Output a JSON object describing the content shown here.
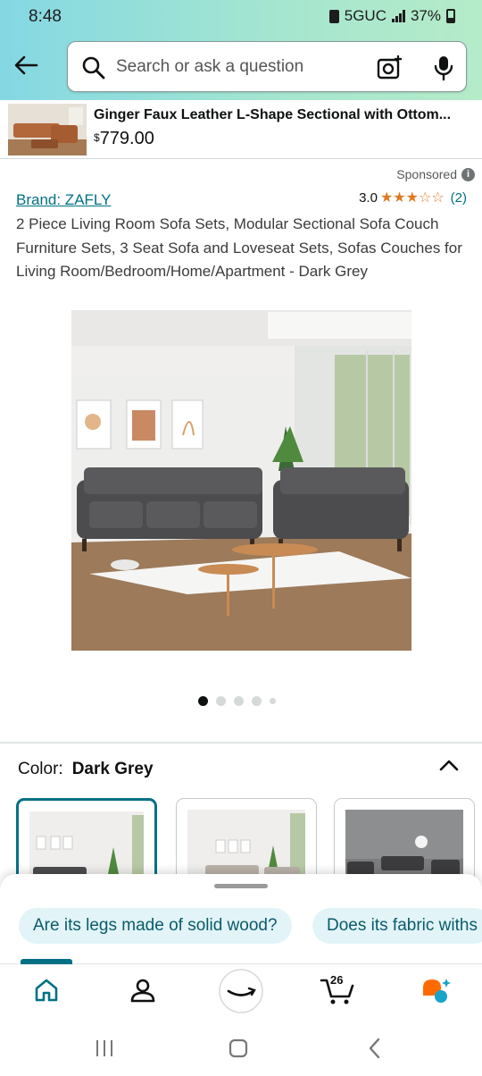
{
  "status": {
    "time": "8:48",
    "network": "5GUC",
    "battery": "37%"
  },
  "search": {
    "placeholder": "Search or ask a question"
  },
  "recent": {
    "title": "Ginger Faux Leather L-Shape Sectional with Ottom...",
    "price_symbol": "$",
    "price": "779.00"
  },
  "sponsored": {
    "label": "Sponsored"
  },
  "product": {
    "brand": "Brand: ZAFLY",
    "rating_value": "3.0",
    "rating_stars": 3,
    "rating_max": 5,
    "rating_count": "(2)",
    "title": "2 Piece Living Room Sofa Sets, Modular Sectional Sofa Couch Furniture Sets, 3 Seat Sofa and Loveseat Sets, Sofas Couches for Living Room/Bedroom/Home/Apartment - Dark Grey"
  },
  "carousel": {
    "total": 5,
    "active": 1
  },
  "color": {
    "label": "Color:",
    "value": "Dark Grey"
  },
  "questions": [
    "Are its legs made of solid wood?",
    "Does its fabric withs"
  ],
  "nav": {
    "cart_count": "26"
  },
  "colors": {
    "accent": "#007185",
    "star": "#de7921",
    "link": "#007185"
  }
}
